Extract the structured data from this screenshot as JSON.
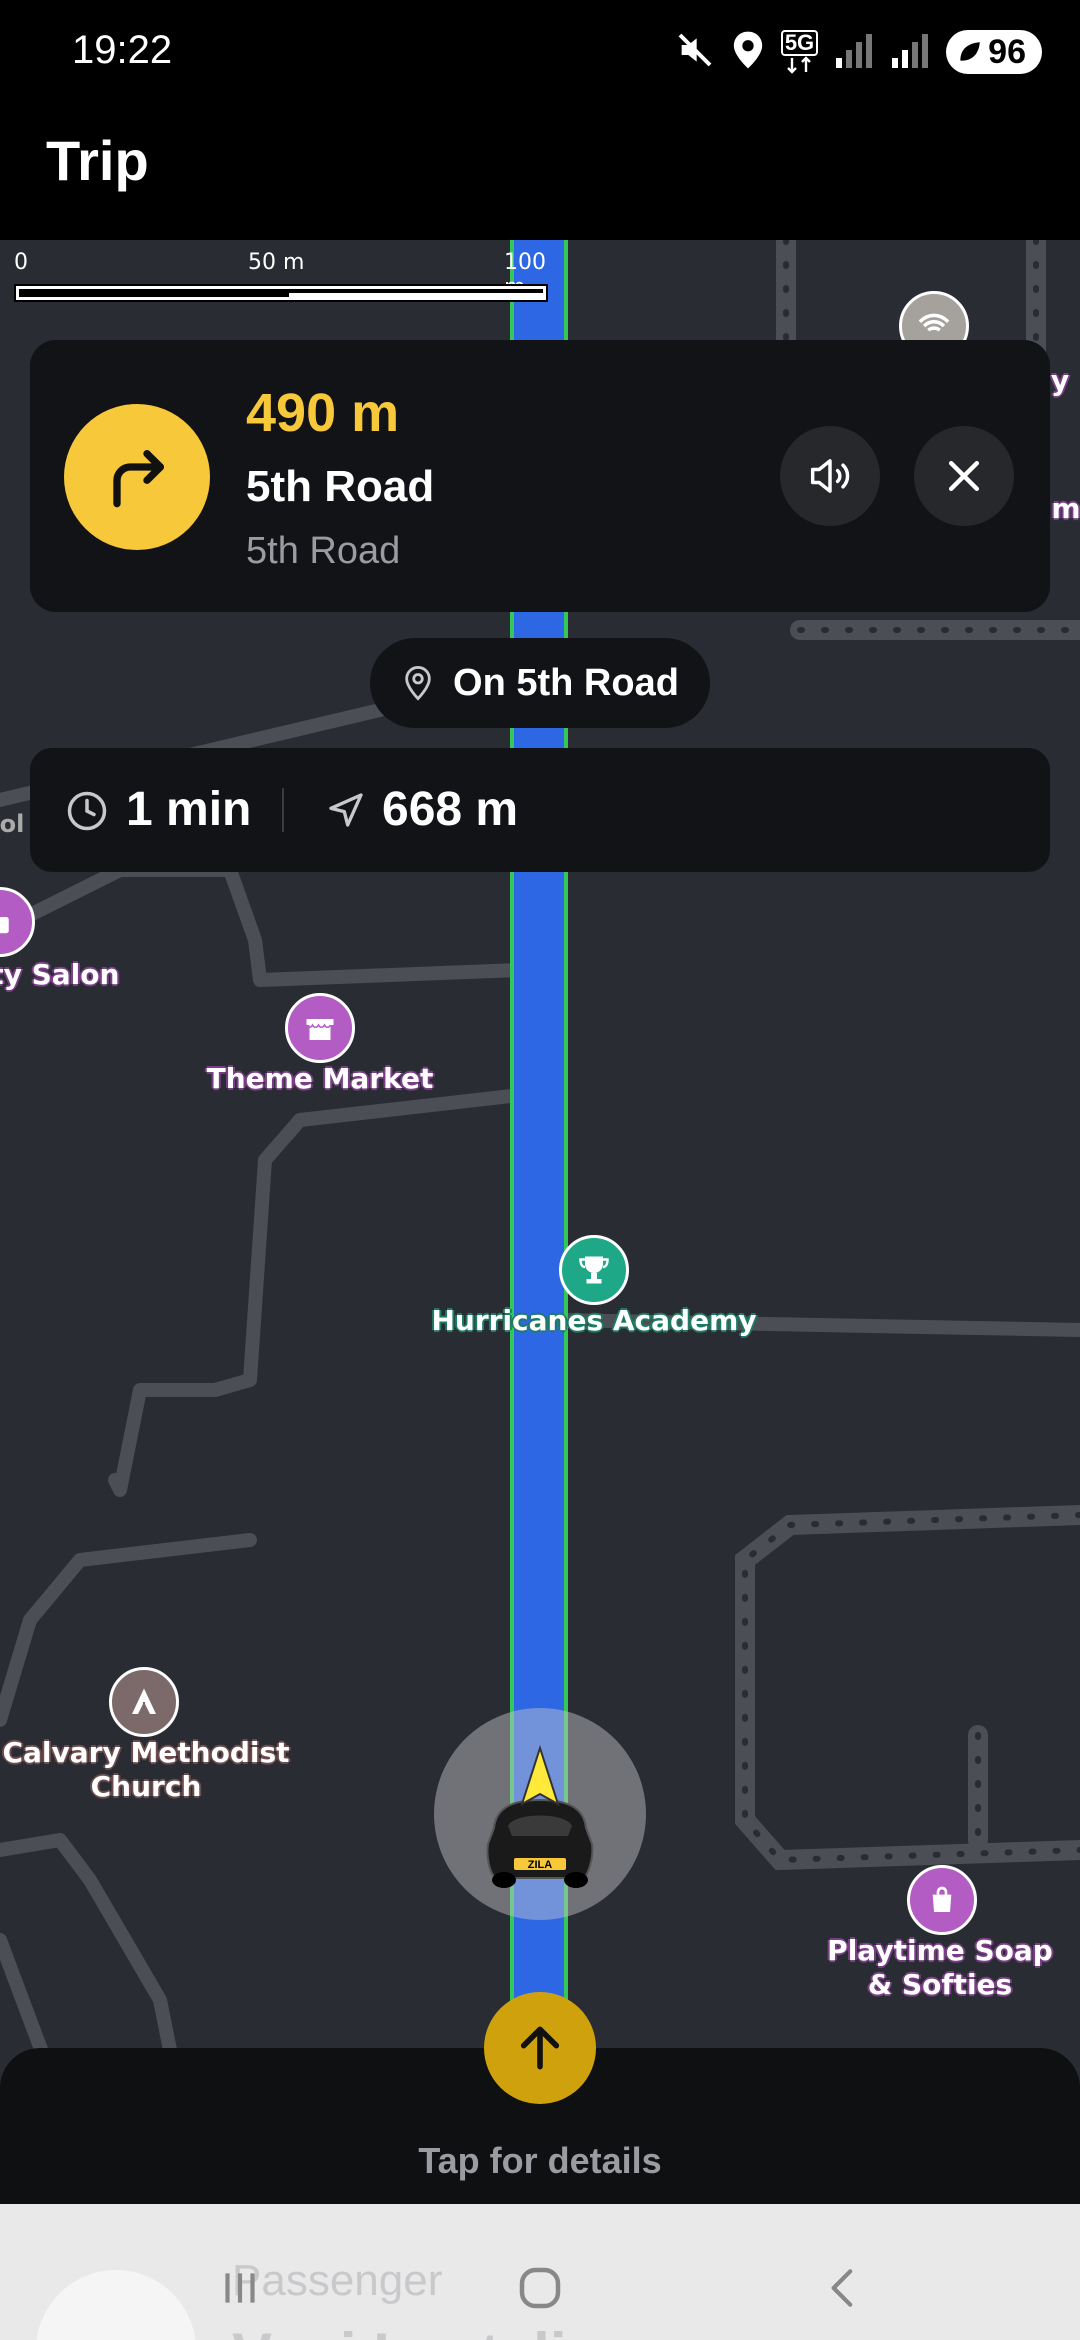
{
  "status_bar": {
    "time": "19:22",
    "network": "5G",
    "battery": "96",
    "icons": [
      "mute-icon",
      "location-icon",
      "5g-icon",
      "signal-icon",
      "signal-icon",
      "battery-icon"
    ]
  },
  "app_bar": {
    "title": "Trip"
  },
  "scale_bar": {
    "labels": [
      "0",
      "50 m",
      "100 m"
    ]
  },
  "instruction": {
    "distance": "490 m",
    "road": "5th Road",
    "sub_road": "5th Road",
    "maneuver_icon": "turn-right-icon",
    "accent_color": "#f6c83a"
  },
  "current_road": {
    "label": "On 5th Road"
  },
  "eta": {
    "time": "1 min",
    "distance": "668 m"
  },
  "map_labels": {
    "salon": "ıty Salon",
    "market": "Theme Market",
    "academy": "Hurricanes Academy",
    "church_line1": "Calvary Methodist",
    "church_line2": "Church",
    "soap_line1": "Playtime Soap",
    "soap_line2": "& Softies",
    "top_right_fragment1": "y",
    "top_right_fragment2": "m",
    "left_fragment": "ol"
  },
  "vehicle": {
    "plate_text": "ZILA"
  },
  "bottom_sheet": {
    "hint": "Tap for details"
  },
  "passenger": {
    "label": "Passenger",
    "name": "Vusi Lentelie"
  },
  "colors": {
    "route": "#2d67e3",
    "route_outline": "#34c759",
    "map_bg": "#292d33",
    "card_bg": "#121316"
  }
}
